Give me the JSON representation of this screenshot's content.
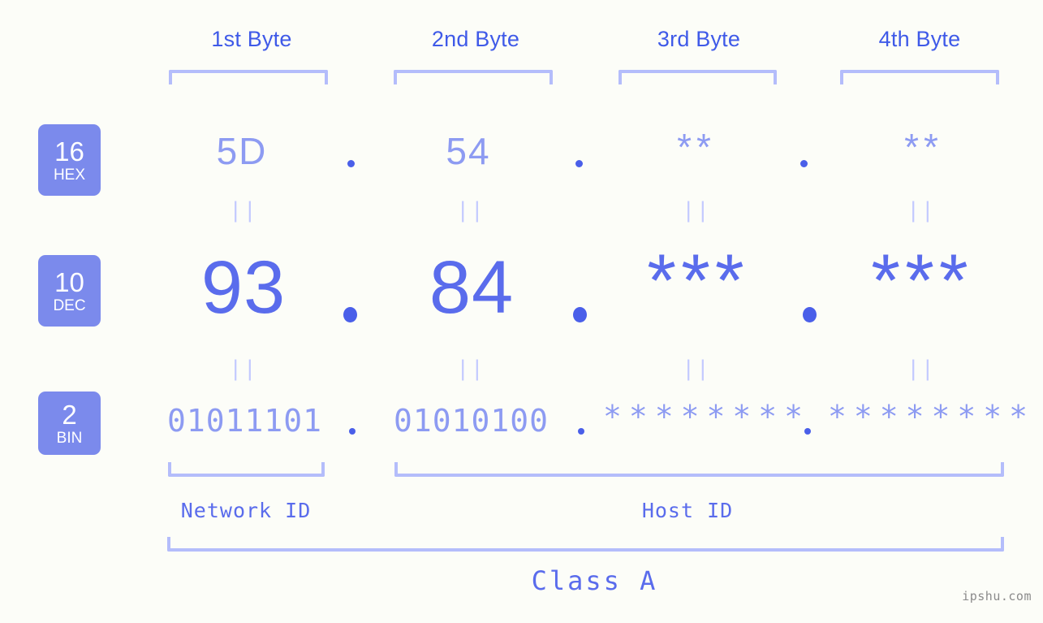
{
  "page": {
    "background_color": "#fcfdf8",
    "accent_strong": "#4a5fe9",
    "accent_light": "#8d9bf2",
    "accent_pale": "#b4bdfb",
    "badge_color": "#7b8aec",
    "watermark": "ipshu.com"
  },
  "byte_headers": [
    {
      "label": "1st Byte"
    },
    {
      "label": "2nd Byte"
    },
    {
      "label": "3rd Byte"
    },
    {
      "label": "4th Byte"
    }
  ],
  "rows": [
    {
      "badge_number": "16",
      "badge_name": "HEX",
      "values": [
        "5D",
        "54",
        "**",
        "**"
      ]
    },
    {
      "badge_number": "10",
      "badge_name": "DEC",
      "values": [
        "93",
        "84",
        "***",
        "***"
      ]
    },
    {
      "badge_number": "2",
      "badge_name": "BIN",
      "values": [
        "01011101",
        "01010100",
        "********",
        "********"
      ]
    }
  ],
  "separators": {
    "dot": "."
  },
  "equals_marks": {
    "glyph": "||"
  },
  "segments": {
    "network_id": "Network ID",
    "host_id": "Host ID",
    "ip_class": "Class A"
  }
}
